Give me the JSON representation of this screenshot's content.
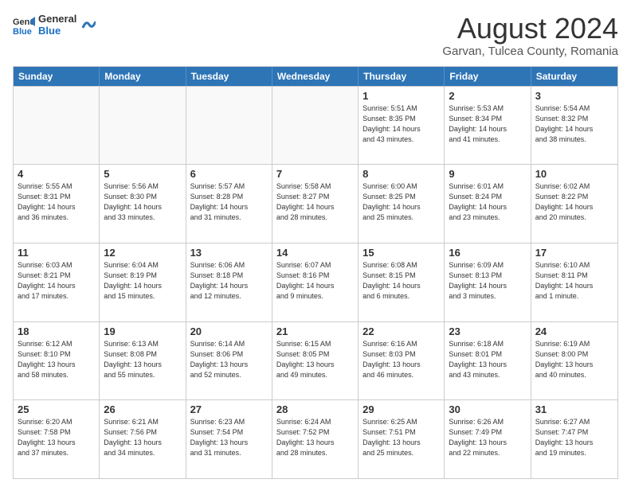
{
  "header": {
    "logo_line1": "General",
    "logo_line2": "Blue",
    "month_title": "August 2024",
    "subtitle": "Garvan, Tulcea County, Romania"
  },
  "days_of_week": [
    "Sunday",
    "Monday",
    "Tuesday",
    "Wednesday",
    "Thursday",
    "Friday",
    "Saturday"
  ],
  "weeks": [
    [
      {
        "day": "",
        "info": ""
      },
      {
        "day": "",
        "info": ""
      },
      {
        "day": "",
        "info": ""
      },
      {
        "day": "",
        "info": ""
      },
      {
        "day": "1",
        "info": "Sunrise: 5:51 AM\nSunset: 8:35 PM\nDaylight: 14 hours\nand 43 minutes."
      },
      {
        "day": "2",
        "info": "Sunrise: 5:53 AM\nSunset: 8:34 PM\nDaylight: 14 hours\nand 41 minutes."
      },
      {
        "day": "3",
        "info": "Sunrise: 5:54 AM\nSunset: 8:32 PM\nDaylight: 14 hours\nand 38 minutes."
      }
    ],
    [
      {
        "day": "4",
        "info": "Sunrise: 5:55 AM\nSunset: 8:31 PM\nDaylight: 14 hours\nand 36 minutes."
      },
      {
        "day": "5",
        "info": "Sunrise: 5:56 AM\nSunset: 8:30 PM\nDaylight: 14 hours\nand 33 minutes."
      },
      {
        "day": "6",
        "info": "Sunrise: 5:57 AM\nSunset: 8:28 PM\nDaylight: 14 hours\nand 31 minutes."
      },
      {
        "day": "7",
        "info": "Sunrise: 5:58 AM\nSunset: 8:27 PM\nDaylight: 14 hours\nand 28 minutes."
      },
      {
        "day": "8",
        "info": "Sunrise: 6:00 AM\nSunset: 8:25 PM\nDaylight: 14 hours\nand 25 minutes."
      },
      {
        "day": "9",
        "info": "Sunrise: 6:01 AM\nSunset: 8:24 PM\nDaylight: 14 hours\nand 23 minutes."
      },
      {
        "day": "10",
        "info": "Sunrise: 6:02 AM\nSunset: 8:22 PM\nDaylight: 14 hours\nand 20 minutes."
      }
    ],
    [
      {
        "day": "11",
        "info": "Sunrise: 6:03 AM\nSunset: 8:21 PM\nDaylight: 14 hours\nand 17 minutes."
      },
      {
        "day": "12",
        "info": "Sunrise: 6:04 AM\nSunset: 8:19 PM\nDaylight: 14 hours\nand 15 minutes."
      },
      {
        "day": "13",
        "info": "Sunrise: 6:06 AM\nSunset: 8:18 PM\nDaylight: 14 hours\nand 12 minutes."
      },
      {
        "day": "14",
        "info": "Sunrise: 6:07 AM\nSunset: 8:16 PM\nDaylight: 14 hours\nand 9 minutes."
      },
      {
        "day": "15",
        "info": "Sunrise: 6:08 AM\nSunset: 8:15 PM\nDaylight: 14 hours\nand 6 minutes."
      },
      {
        "day": "16",
        "info": "Sunrise: 6:09 AM\nSunset: 8:13 PM\nDaylight: 14 hours\nand 3 minutes."
      },
      {
        "day": "17",
        "info": "Sunrise: 6:10 AM\nSunset: 8:11 PM\nDaylight: 14 hours\nand 1 minute."
      }
    ],
    [
      {
        "day": "18",
        "info": "Sunrise: 6:12 AM\nSunset: 8:10 PM\nDaylight: 13 hours\nand 58 minutes."
      },
      {
        "day": "19",
        "info": "Sunrise: 6:13 AM\nSunset: 8:08 PM\nDaylight: 13 hours\nand 55 minutes."
      },
      {
        "day": "20",
        "info": "Sunrise: 6:14 AM\nSunset: 8:06 PM\nDaylight: 13 hours\nand 52 minutes."
      },
      {
        "day": "21",
        "info": "Sunrise: 6:15 AM\nSunset: 8:05 PM\nDaylight: 13 hours\nand 49 minutes."
      },
      {
        "day": "22",
        "info": "Sunrise: 6:16 AM\nSunset: 8:03 PM\nDaylight: 13 hours\nand 46 minutes."
      },
      {
        "day": "23",
        "info": "Sunrise: 6:18 AM\nSunset: 8:01 PM\nDaylight: 13 hours\nand 43 minutes."
      },
      {
        "day": "24",
        "info": "Sunrise: 6:19 AM\nSunset: 8:00 PM\nDaylight: 13 hours\nand 40 minutes."
      }
    ],
    [
      {
        "day": "25",
        "info": "Sunrise: 6:20 AM\nSunset: 7:58 PM\nDaylight: 13 hours\nand 37 minutes."
      },
      {
        "day": "26",
        "info": "Sunrise: 6:21 AM\nSunset: 7:56 PM\nDaylight: 13 hours\nand 34 minutes."
      },
      {
        "day": "27",
        "info": "Sunrise: 6:23 AM\nSunset: 7:54 PM\nDaylight: 13 hours\nand 31 minutes."
      },
      {
        "day": "28",
        "info": "Sunrise: 6:24 AM\nSunset: 7:52 PM\nDaylight: 13 hours\nand 28 minutes."
      },
      {
        "day": "29",
        "info": "Sunrise: 6:25 AM\nSunset: 7:51 PM\nDaylight: 13 hours\nand 25 minutes."
      },
      {
        "day": "30",
        "info": "Sunrise: 6:26 AM\nSunset: 7:49 PM\nDaylight: 13 hours\nand 22 minutes."
      },
      {
        "day": "31",
        "info": "Sunrise: 6:27 AM\nSunset: 7:47 PM\nDaylight: 13 hours\nand 19 minutes."
      }
    ]
  ]
}
